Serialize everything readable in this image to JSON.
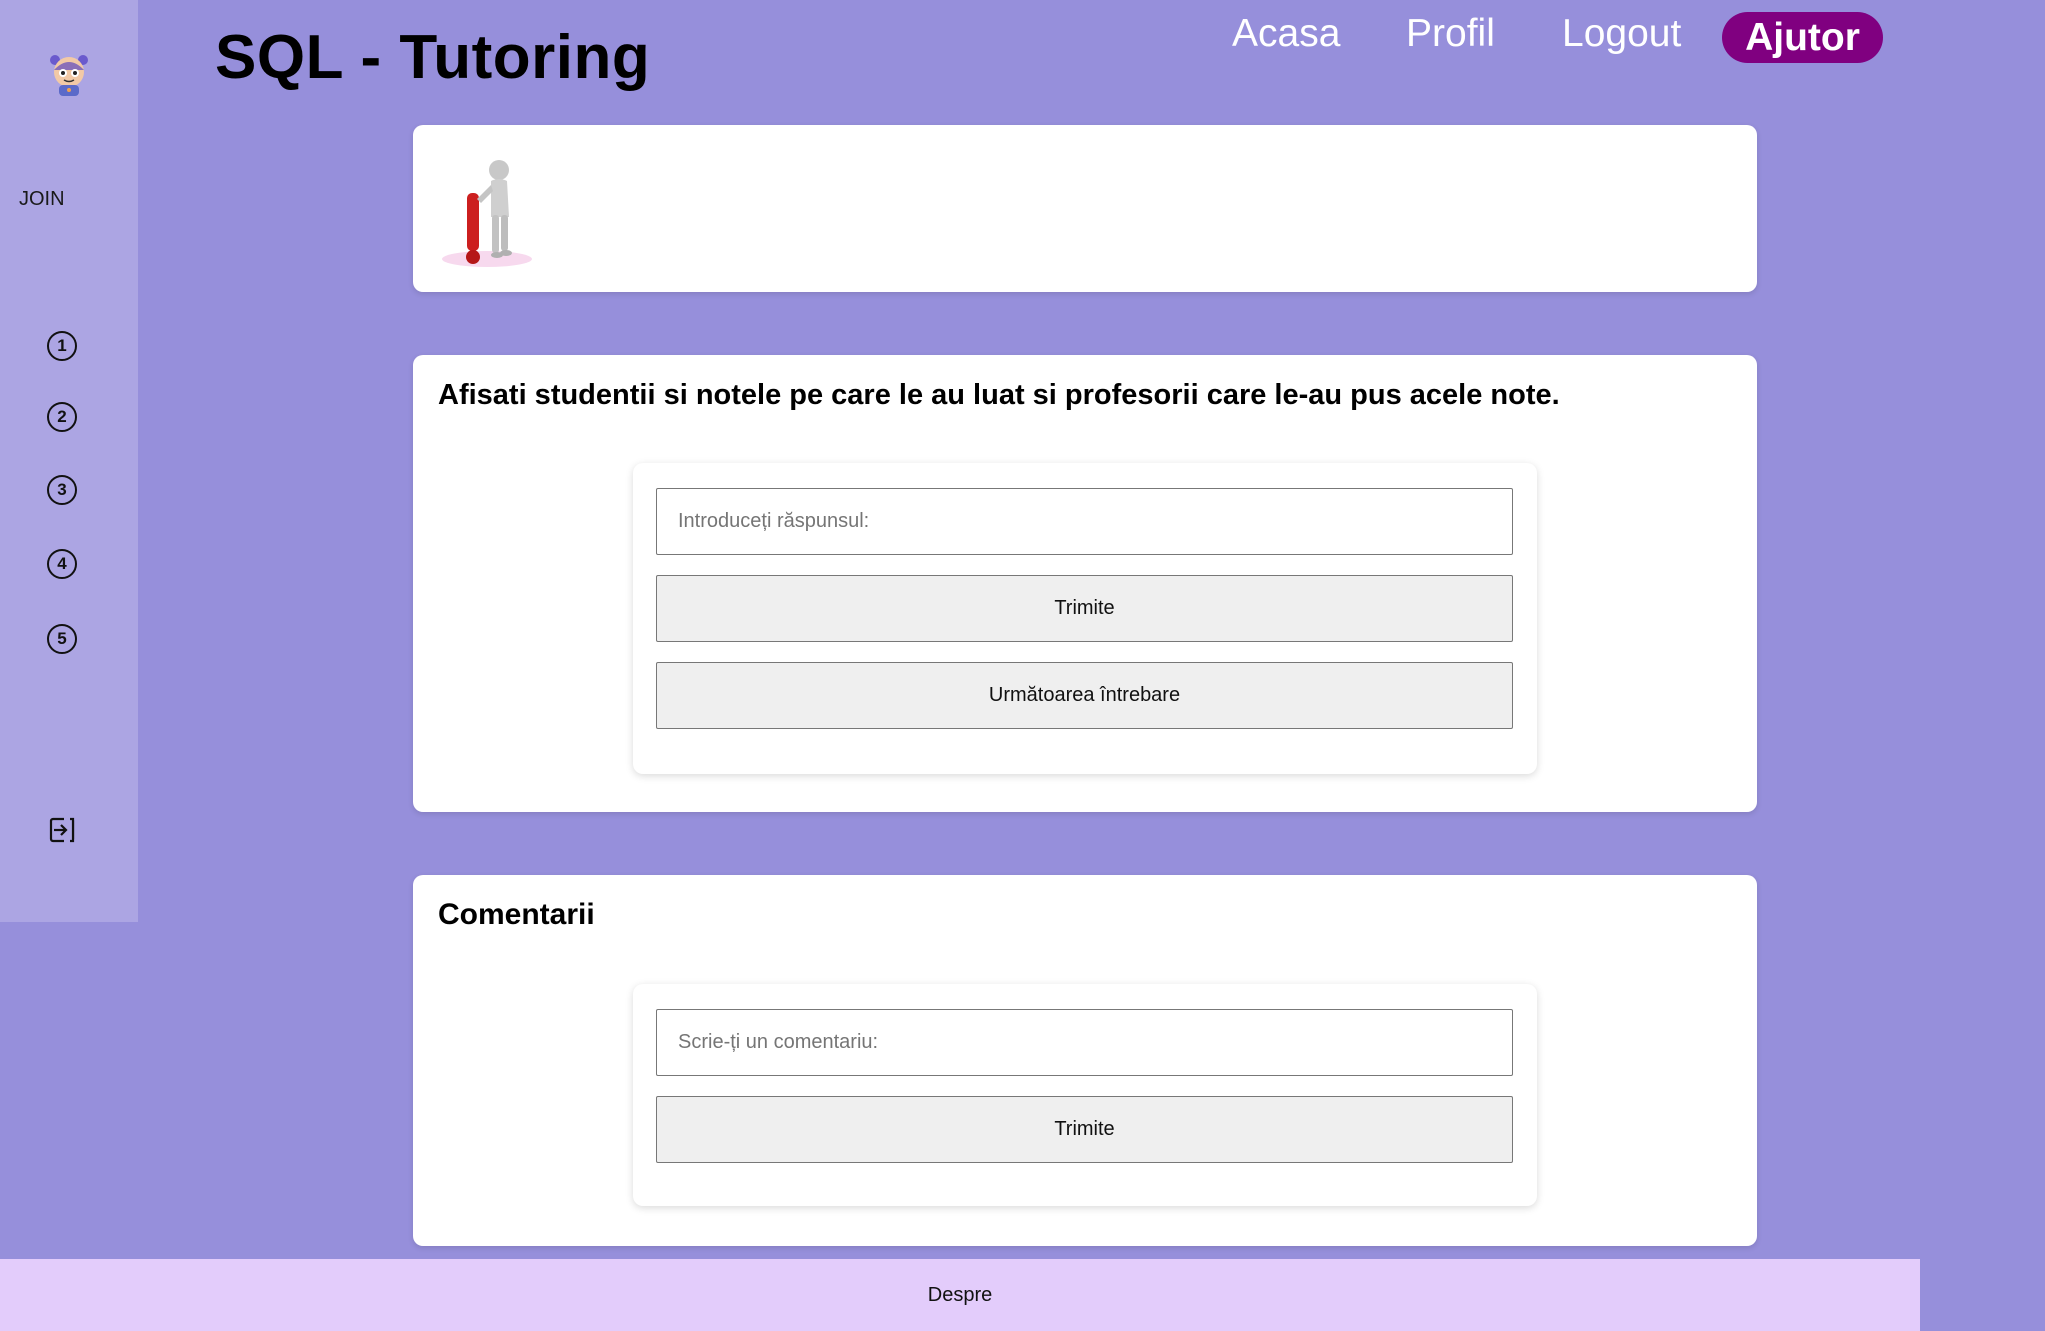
{
  "header": {
    "title": "SQL - Tutoring",
    "nav": {
      "home": "Acasa",
      "profile": "Profil",
      "logout": "Logout",
      "help": "Ajutor"
    }
  },
  "sidebar": {
    "join_label": "JOIN",
    "steps": [
      "1",
      "2",
      "3",
      "4",
      "5"
    ],
    "icons": {
      "mascot": "robot-mascot-icon",
      "exit": "sign-out-icon"
    }
  },
  "question_card": {
    "text": "Afisati studentii si notele pe care le au luat si profesorii care le-au pus acele note.",
    "answer_placeholder": "Introduceți răspunsul:",
    "submit_label": "Trimite",
    "next_label": "Următoarea întrebare"
  },
  "comments_card": {
    "title": "Comentarii",
    "comment_placeholder": "Scrie-ți un comentariu:",
    "submit_label": "Trimite"
  },
  "footer": {
    "about": "Despre"
  },
  "colors": {
    "background": "#968fdb",
    "sidebar": "#aca5e3",
    "help_button": "#800080",
    "footer": "#e3ccfb",
    "exclamation": "#cc1f1f"
  }
}
